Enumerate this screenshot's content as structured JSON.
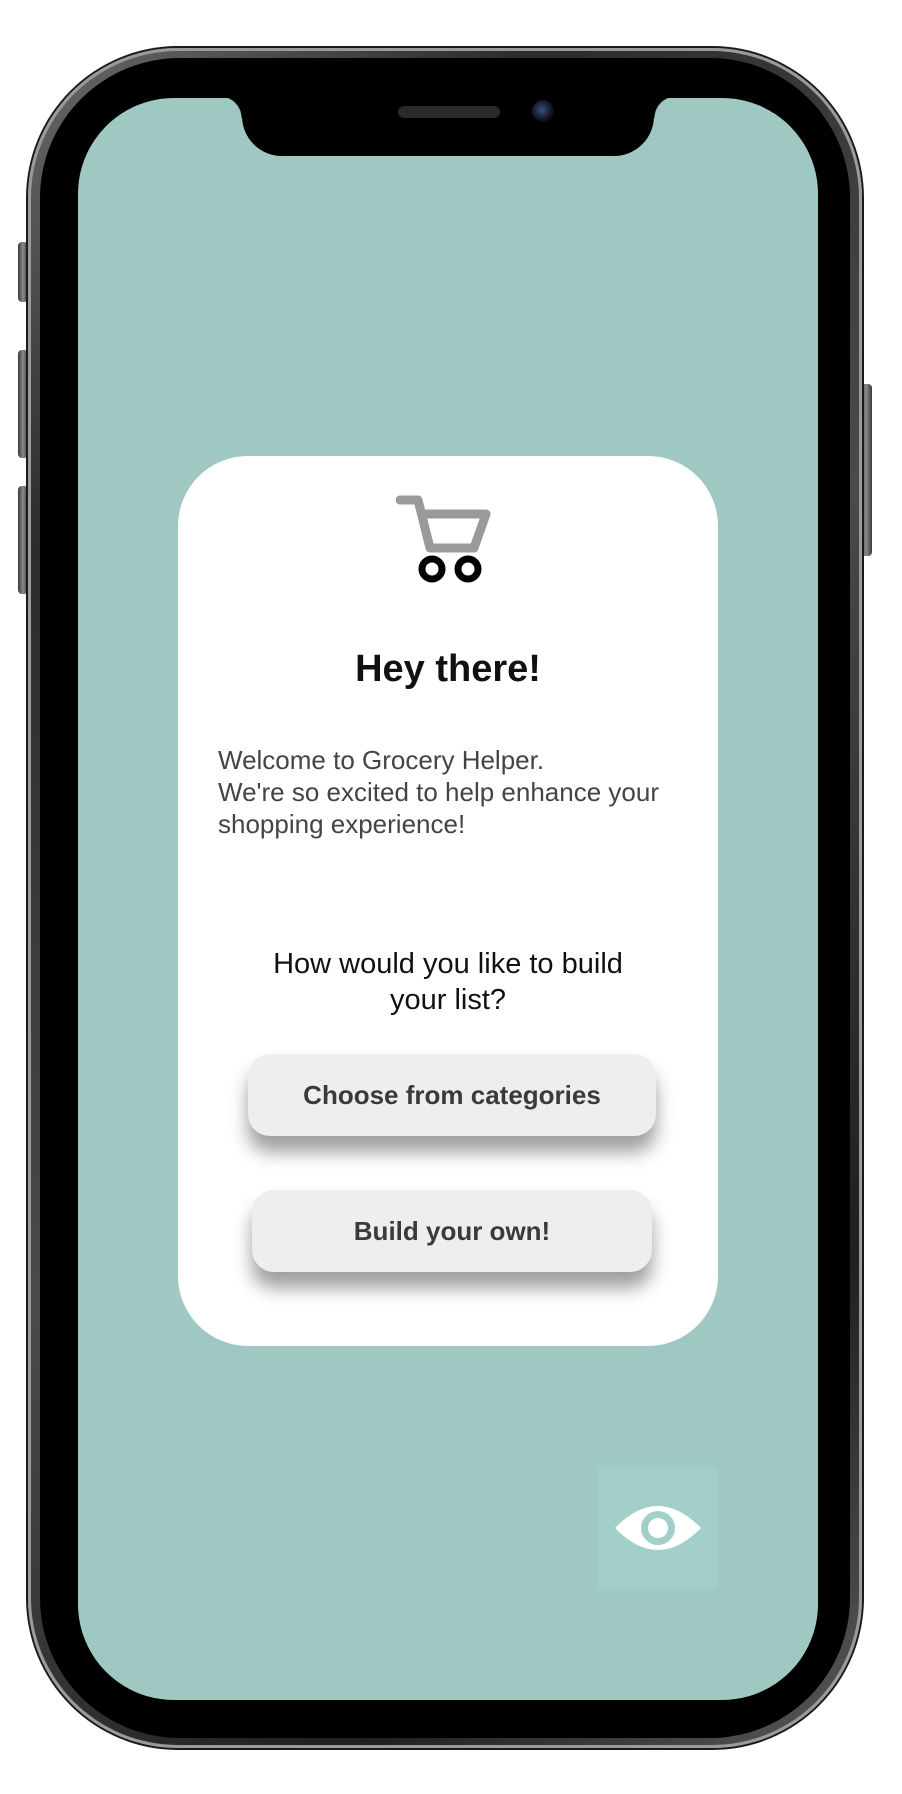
{
  "welcome_card": {
    "title": "Hey there!",
    "welcome_lines": [
      "Welcome to Grocery Helper.",
      "We're so excited to help enhance your",
      "shopping experience!"
    ],
    "question_lines": [
      "How would you like to build",
      "your list?"
    ],
    "buttons": {
      "choose_categories": "Choose from categories",
      "build_own": "Build your own!"
    }
  },
  "icons": {
    "cart": "shopping-cart-icon",
    "eye": "eye-icon"
  },
  "colors": {
    "screen_background": "#a0c8c3",
    "eye_button_background": "#a2cfca",
    "card_background": "#ffffff",
    "button_background": "#eeeeee"
  }
}
